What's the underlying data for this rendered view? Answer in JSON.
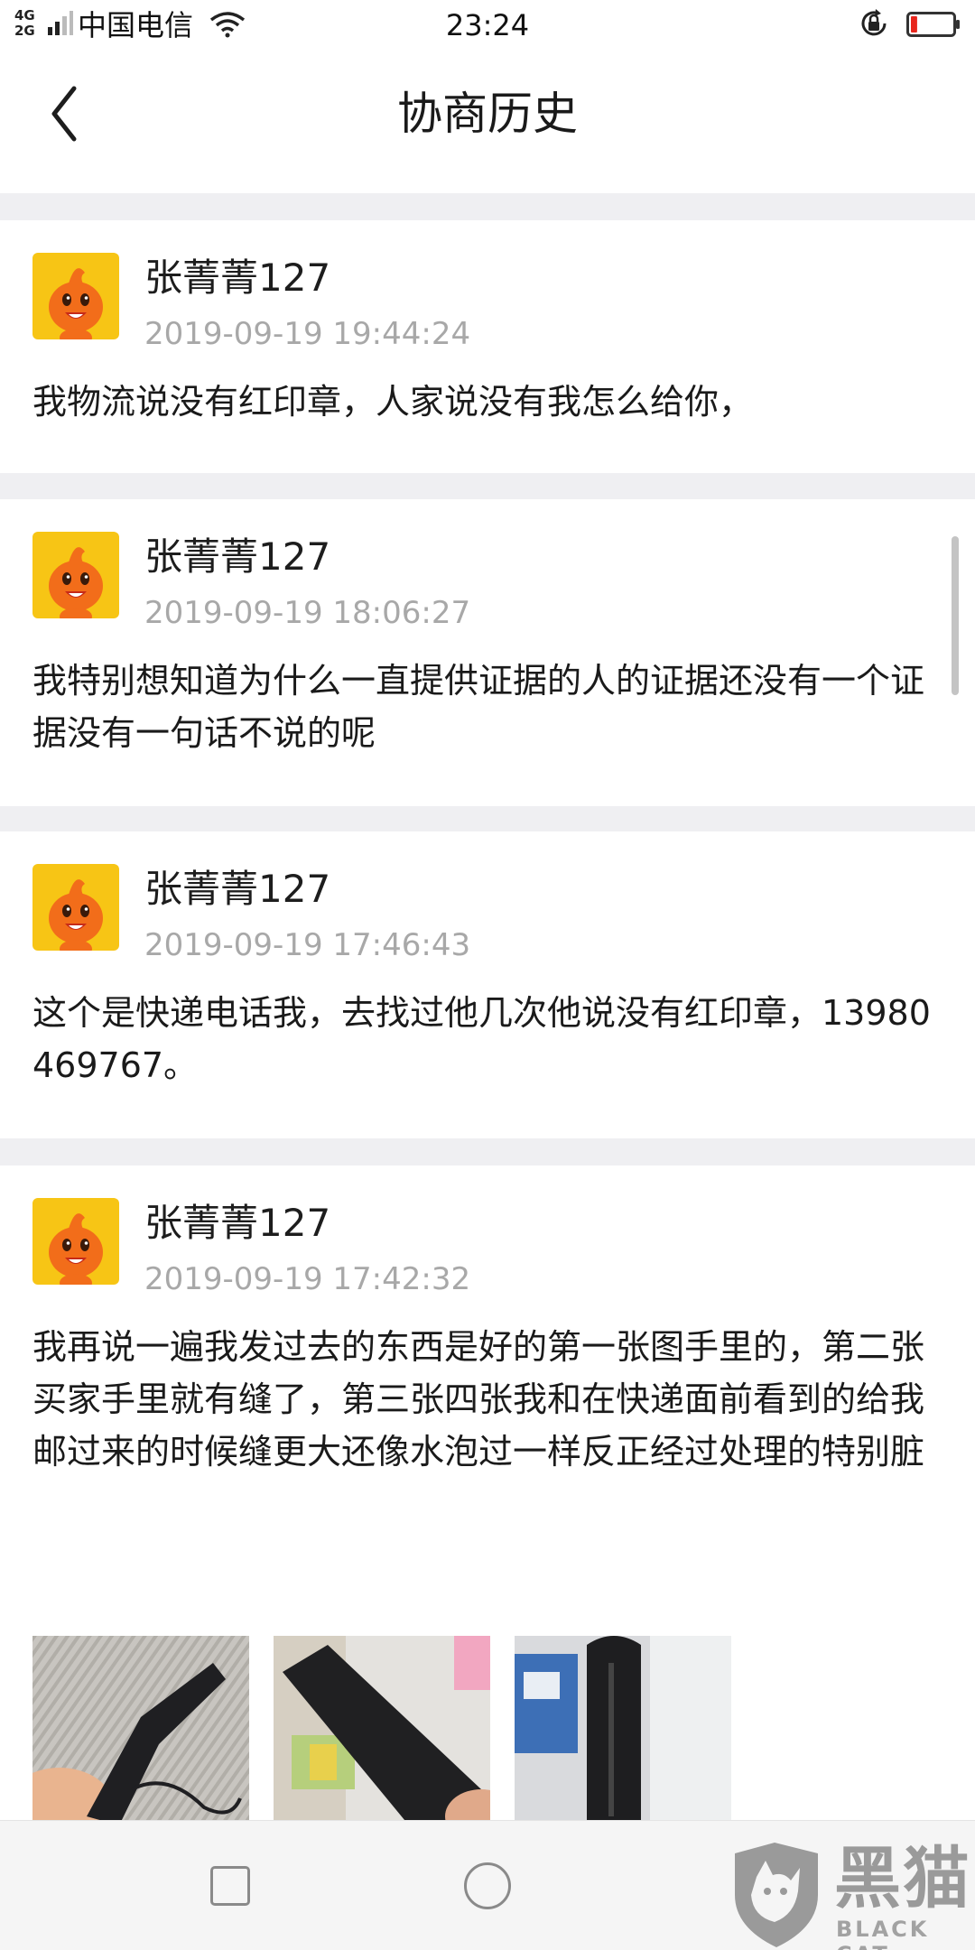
{
  "status_bar": {
    "network_top": "4G",
    "network_bottom": "2G",
    "carrier": "中国电信",
    "time": "23:24",
    "battery_level": 0.15,
    "battery_color": "#e8261d"
  },
  "header": {
    "title": "协商历史"
  },
  "messages": [
    {
      "user": "张菁菁127",
      "time": "2019-09-19 19:44:24",
      "text": "我物流说没有红印章，人家说没有我怎么给你，"
    },
    {
      "user": "张菁菁127",
      "time": "2019-09-19 18:06:27",
      "text": "我特别想知道为什么一直提供证据的人的证据还没有一个证据没有一句话不说的呢"
    },
    {
      "user": "张菁菁127",
      "time": "2019-09-19 17:46:43",
      "text": "这个是快递电话我，去找过他几次他说没有红印章，13980469767。"
    },
    {
      "user": "张菁菁127",
      "time": "2019-09-19 17:42:32",
      "text": "我再说一遍我发过去的东西是好的第一张图手里的，第二张买家手里就有缝了，第三张四张我和在快递面前看到的给我邮过来的时候缝更大还像水泡过一样反正经过处理的特别脏"
    }
  ],
  "watermark": {
    "cn": "黑猫",
    "en": "BLACK CAT"
  },
  "colors": {
    "avatar_bg": "#f7c515",
    "avatar_face": "#f26d1a",
    "timestamp": "#a8a8a8",
    "page_bg": "#efeff2"
  }
}
